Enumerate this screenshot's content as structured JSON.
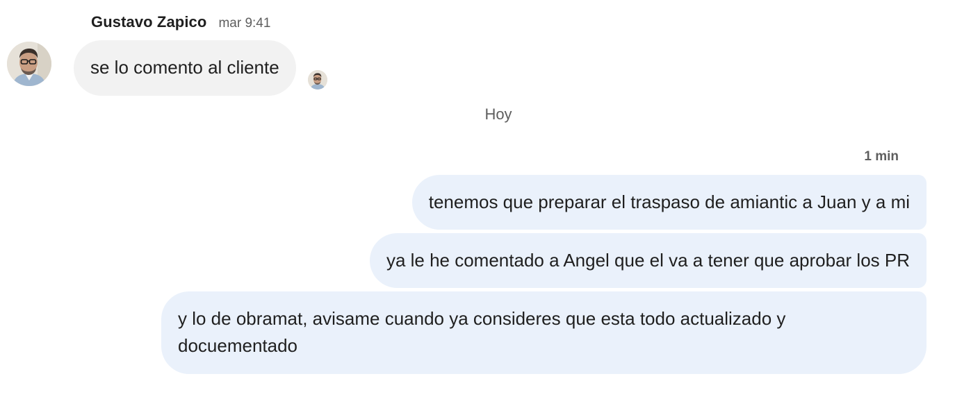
{
  "incoming": {
    "sender_name": "Gustavo Zapico",
    "timestamp": "mar 9:41",
    "message": "se lo comento al cliente",
    "avatar_icon": "person-photo-icon",
    "read_receipt_icon": "seen-by-avatar-icon"
  },
  "divider": {
    "label": "Hoy"
  },
  "outgoing": {
    "timestamp": "1 min",
    "messages": [
      "tenemos que preparar el traspaso de amiantic a Juan y a mi",
      "ya le he comentado a Angel que el va a tener que aprobar los PR",
      "y lo de obramat, avisame cuando ya consideres que esta todo actualizado y docuementado"
    ]
  },
  "colors": {
    "incoming_bubble": "#f2f2f2",
    "outgoing_bubble": "#eaf1fb",
    "text": "#1f1f1f",
    "secondary_text": "#5e5e5e"
  }
}
